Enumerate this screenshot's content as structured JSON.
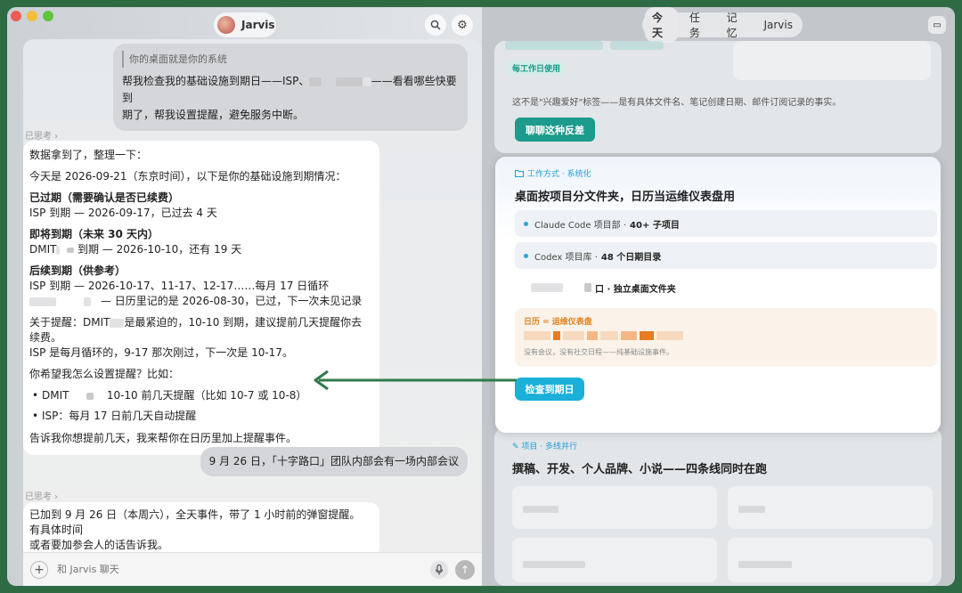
{
  "window": {
    "traffic_colors": [
      "#ee5b52",
      "#f3bd3a",
      "#5fc43f"
    ]
  },
  "header": {
    "agent_name": "Jarvis",
    "search_icon": "search-icon",
    "settings_icon": "gear-icon"
  },
  "chat": {
    "msg1": {
      "quote": "你的桌面就是你的系统",
      "text_a": "帮我检查我的基础设施到期日——ISP、",
      "text_b": "——看看哪些快要到",
      "text_c": "期了，帮我设置提醒，避免服务中断。"
    },
    "thought_label_1": "已思考  ›",
    "reply1": {
      "intro": "数据拿到了，整理一下：",
      "today": "今天是 2026-09-21（东京时间），以下是你的基础设施到期情况：",
      "expired_h": "已过期（需要确认是否已续费）",
      "expired_1": "ISP 到期 — 2026-09-17，已过去 4 天",
      "soon_h": "即将到期（未来 30 天内）",
      "soon_1a": "DMIT",
      "soon_1b": "到期 — 2026-10-10，还有 19 天",
      "later_h": "后续到期（供参考）",
      "later_1": "ISP 到期 — 2026-10-17、11-17、12-17……每月 17 日循环",
      "later_2": "— 日历里记的是 2026-08-30，已过，下一次未见记录",
      "remind_1a": "关于提醒：DMIT",
      "remind_1b": "是最紧迫的，10-10 到期，建议提前几天提醒你去续费。",
      "remind_2": "ISP 是每月循环的，9-17 那次刚过，下一次是 10-17。",
      "ask": "你希望我怎么设置提醒？比如：",
      "opt1a": "DMIT",
      "opt1b": "10-10 前几天提醒（比如 10-7 或 10-8）",
      "opt2": "ISP：每月 17 日前几天自动提醒",
      "close": "告诉我你想提前几天，我来帮你在日历里加上提醒事件。"
    },
    "msg2": "9 月 26 日，「十字路口」团队内部会有一场内部会议",
    "thought_label_2": "已思考  ›",
    "reply2_a": "已加到 9 月 26 日（本周六），全天事件，带了 1 小时前的弹窗提醒。有具体时间",
    "reply2_b": "或者要加参会人的话告诉我。",
    "composer_placeholder": "和 Jarvis 聊天"
  },
  "right": {
    "tabs": [
      "今天",
      "任务",
      "记忆",
      "Jarvis"
    ],
    "active_tab": "今天",
    "top_card": {
      "badge": "每工作日使用",
      "note": "这不是\"兴趣爱好\"标签——是有具体文件名、笔记创建日期、邮件订阅记录的事实。",
      "button": "聊聊这种反差"
    },
    "focus_card": {
      "tag": "工作方式 · 系统化",
      "title": "桌面按项目分文件夹，日历当运维仪表盘用",
      "row1_a": "Claude Code 项目部 ·",
      "row1_b": "40+ 子项目",
      "row2_a": "Codex 项目库 ·",
      "row2_b": "48 个日期目录",
      "row3_b": "口 · 独立桌面文件夹",
      "calendar_title": "日历 = 运维仪表盘",
      "calendar_note": "没有会议，没有社交日程——纯基础设施事件。",
      "button": "检查到期日"
    },
    "bottom_card": {
      "tag": "项目 · 多线并行",
      "title": "撰稿、开发、个人品牌、小说——四条线同时在跑"
    },
    "accent": "#1bb0d9",
    "teal": "#1c9b8c"
  }
}
